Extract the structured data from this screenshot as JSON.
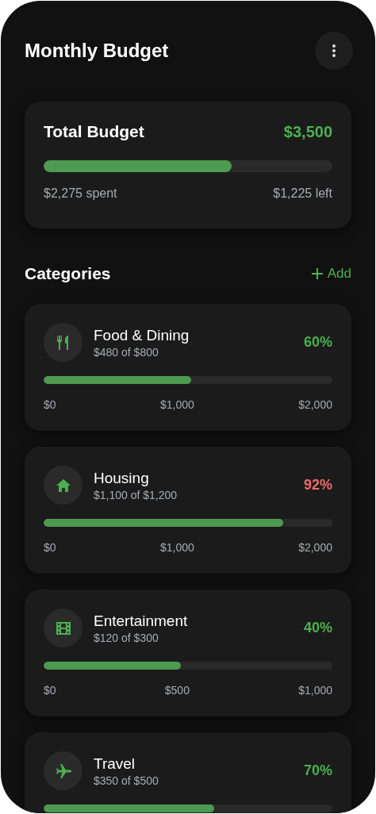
{
  "header": {
    "title": "Monthly Budget"
  },
  "total": {
    "label": "Total Budget",
    "amount": "$3,500",
    "level": 0.65,
    "spent": "$2,275 spent",
    "left": "$1,225 left"
  },
  "categories_header": {
    "title": "Categories",
    "add_label": "Add"
  },
  "categories": [
    {
      "kind": "dining",
      "name": "Food & Dining",
      "amount": "$480 of $800",
      "percent": "60%",
      "over_limit": false,
      "level": 0.51,
      "ticks": [
        "$0",
        "$1,000",
        "$2,000"
      ]
    },
    {
      "kind": "housing",
      "name": "Housing",
      "amount": "$1,100 of $1,200",
      "percent": "92%",
      "over_limit": true,
      "level": 0.83,
      "ticks": [
        "$0",
        "$1,000",
        "$2,000"
      ]
    },
    {
      "kind": "entertainment",
      "name": "Entertainment",
      "amount": "$120 of $300",
      "percent": "40%",
      "over_limit": false,
      "level": 0.475,
      "ticks": [
        "$0",
        "$500",
        "$1,000"
      ]
    },
    {
      "kind": "travel",
      "name": "Travel",
      "amount": "$350 of $500",
      "percent": "70%",
      "over_limit": false,
      "level": 0.59
    }
  ]
}
